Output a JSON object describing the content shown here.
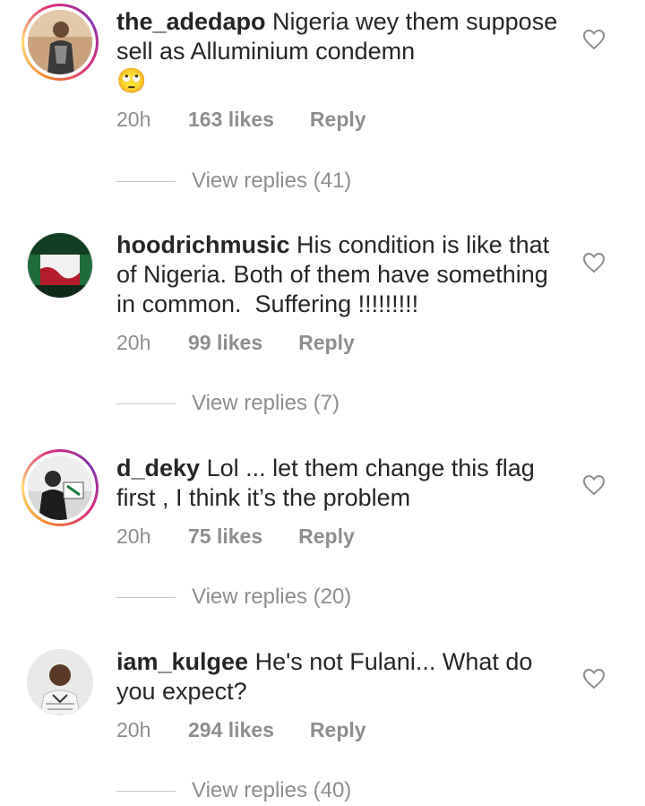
{
  "comments": [
    {
      "username": "the_adedapo",
      "text": " Nigeria wey them suppose sell as Alluminium condemn\n🙄",
      "time": "20h",
      "likes": "163 likes",
      "reply_label": "Reply",
      "view_replies": "View replies (41)",
      "story_ring": true
    },
    {
      "username": "hoodrichmusic",
      "text": " His condition is like that of Nigeria. Both of them have something in common.  Suffering !!!!!!!!!",
      "time": "20h",
      "likes": "99 likes",
      "reply_label": "Reply",
      "view_replies": "View replies (7)",
      "story_ring": false
    },
    {
      "username": "d_deky",
      "text": " Lol ... let them change this flag first , I think it’s the problem",
      "time": "20h",
      "likes": "75 likes",
      "reply_label": "Reply",
      "view_replies": "View replies (20)",
      "story_ring": true
    },
    {
      "username": "iam_kulgee",
      "text": " He's not Fulani... What do you expect?",
      "time": "20h",
      "likes": "294 likes",
      "reply_label": "Reply",
      "view_replies": "View replies (40)",
      "story_ring": false
    }
  ],
  "icons": {
    "like": "heart-outline-icon"
  },
  "colors": {
    "ring_start": "#f58529",
    "ring_end": "#dd2a7b",
    "muted": "#8e8e8e"
  }
}
